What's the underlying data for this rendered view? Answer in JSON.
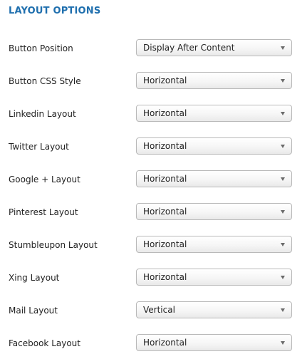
{
  "section": {
    "title": "LAYOUT OPTIONS"
  },
  "fields": [
    {
      "label": "Button Position",
      "value": "Display After Content"
    },
    {
      "label": "Button CSS Style",
      "value": "Horizontal"
    },
    {
      "label": "Linkedin Layout",
      "value": "Horizontal"
    },
    {
      "label": "Twitter Layout",
      "value": "Horizontal"
    },
    {
      "label": "Google + Layout",
      "value": "Horizontal"
    },
    {
      "label": "Pinterest Layout",
      "value": "Horizontal"
    },
    {
      "label": "Stumbleupon Layout",
      "value": "Horizontal"
    },
    {
      "label": "Xing Layout",
      "value": "Horizontal"
    },
    {
      "label": "Mail Layout",
      "value": "Vertical"
    },
    {
      "label": "Facebook Layout",
      "value": "Horizontal"
    }
  ],
  "icons": {
    "dropdown": "chevron-down-icon"
  },
  "colors": {
    "title": "#1f6fae",
    "text": "#222222",
    "select_border": "#b9b9b9"
  }
}
